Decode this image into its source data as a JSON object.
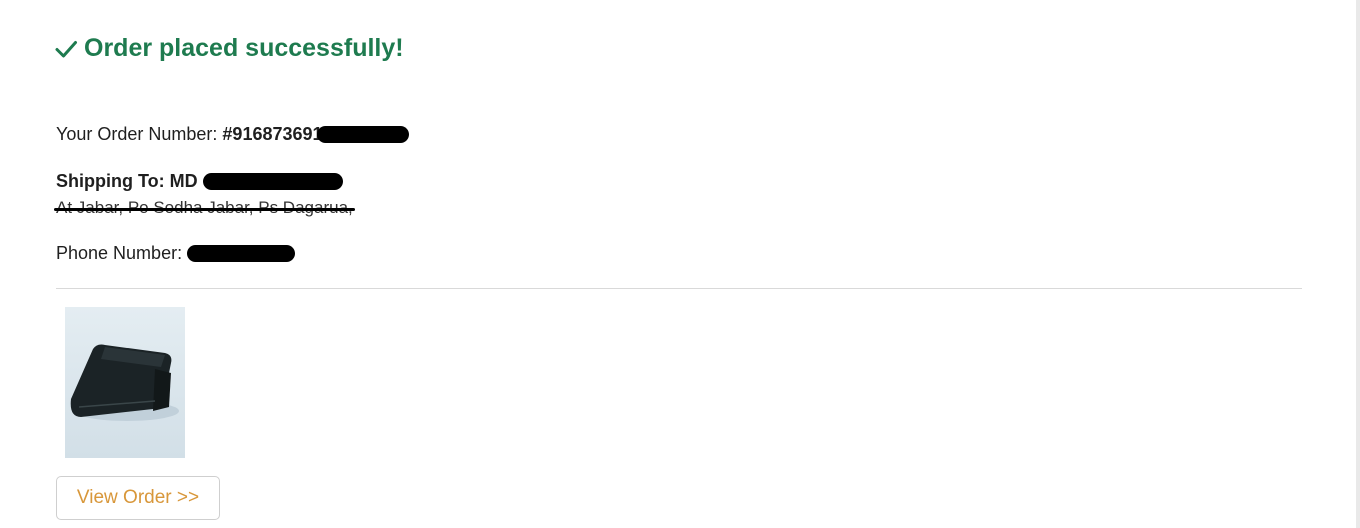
{
  "success": {
    "message": "Order placed successfully!",
    "icon": "check-icon",
    "color": "#1e7b4f"
  },
  "order": {
    "label": "Your Order Number:",
    "number_visible": "#916873691",
    "redacted": true
  },
  "shipping": {
    "label": "Shipping To:",
    "name_visible": "MD",
    "name_redacted": true,
    "address_visible": "At Jabar, Po Sodha Jabar, Ps Dagarua,",
    "address_struck_through": true
  },
  "phone": {
    "label": "Phone Number:",
    "redacted": true
  },
  "product": {
    "image": "wallet-product-image"
  },
  "actions": {
    "view_order_label": "View Order >>",
    "view_order_color": "#d8973a"
  }
}
